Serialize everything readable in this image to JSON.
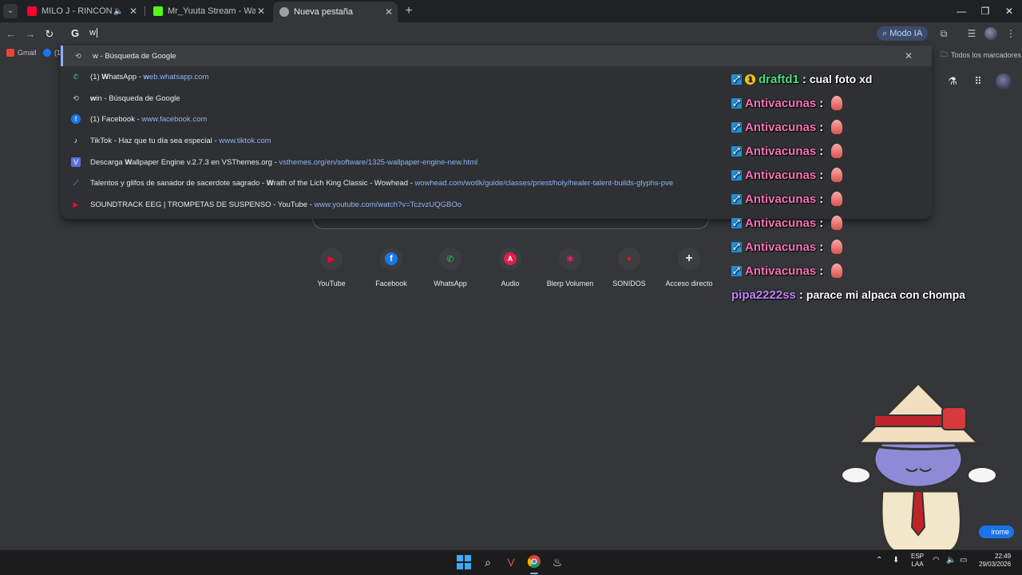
{
  "tabs": [
    {
      "title": "MILO J - RINCÓN (En Vivo | ",
      "favicon_color": "#ff0033",
      "muted_icon": "speaker-icon"
    },
    {
      "title": "Mr_Yuuta Stream - Watch Live",
      "favicon_color": "#53fc18"
    },
    {
      "title": "Nueva pestaña",
      "favicon_color": "#9aa0a6",
      "active": true
    }
  ],
  "omnibox": {
    "value": "w",
    "modo_ia": "Modo IA"
  },
  "bookmarks": {
    "gmail": "Gmail",
    "facebook_count": "(1",
    "all_bookmarks": "Todos los marcadores"
  },
  "suggestions": [
    {
      "bold": "w",
      "rest": " - Búsqueda de Google",
      "url": "",
      "icon": "history-icon",
      "selected": true
    },
    {
      "prefix": "(1) ",
      "bold": "W",
      "rest": "hatsApp - ",
      "url": "web.whatsapp.com",
      "url_bold": "w",
      "icon": "whatsapp-icon"
    },
    {
      "bold": "w",
      "rest": "in - Búsqueda de Google",
      "url": "",
      "icon": "history-icon"
    },
    {
      "prefix": "(1) Facebook - ",
      "bold": "",
      "rest": "",
      "url": "www.facebook.com",
      "url_bold": "w",
      "icon": "facebook-icon"
    },
    {
      "prefix": "TikTok - Haz que tu día sea especial - ",
      "bold": "",
      "rest": "",
      "url": "www.tiktok.com",
      "url_bold": "w",
      "icon": "tiktok-icon"
    },
    {
      "prefix": "Descarga ",
      "bold": "W",
      "rest": "allpaper Engine v.2.7.3 en VSThemes.org - ",
      "url": "vsthemes.org/en/software/1325-wallpaper-engine-new.html",
      "url_bold": "",
      "icon": "vsthemes-icon"
    },
    {
      "prefix": "Talentos y glifos de sanador de sacerdote sagrado - ",
      "bold": "W",
      "rest": "rath of the Lich King Classic - Wowhead - ",
      "url": "wowhead.com/wotlk/guide/classes/priest/holy/healer-talent-builds-glyphs-pve",
      "url_bold": "w",
      "icon": "wowhead-icon"
    },
    {
      "prefix": "SOUNDTRACK EEG | TROMPETAS DE SUSPENSO - YouTube - ",
      "bold": "",
      "rest": "",
      "url": "www.youtube.com/watch?v=TczvzUQGBOo",
      "url_bold": "w",
      "icon": "youtube-icon"
    }
  ],
  "shortcuts": [
    {
      "label": "YouTube",
      "glyph": "▶",
      "color": "#ff0033"
    },
    {
      "label": "Facebook",
      "glyph": "f",
      "color": "#1877f2"
    },
    {
      "label": "WhatsApp",
      "glyph": "✆",
      "color": "#25d366"
    },
    {
      "label": "Audio",
      "glyph": "A",
      "color": "#e11d48"
    },
    {
      "label": "Blerp Volumen",
      "glyph": "✱",
      "color": "#e0245e"
    },
    {
      "label": "SONIDOS",
      "glyph": "●",
      "color": "#c81e1e"
    },
    {
      "label": "Acceso directo",
      "glyph": "+",
      "color": "#e8eaed"
    }
  ],
  "chat": [
    {
      "user": "draftd1",
      "text": "cual foto xd",
      "color": "green",
      "badges": 2
    },
    {
      "user": "Antivacunas",
      "text": "",
      "color": "pink",
      "badges": 1,
      "emote": true
    },
    {
      "user": "Antivacunas",
      "text": "",
      "color": "pink",
      "badges": 1,
      "emote": true
    },
    {
      "user": "Antivacunas",
      "text": "",
      "color": "pink",
      "badges": 1,
      "emote": true
    },
    {
      "user": "Antivacunas",
      "text": "",
      "color": "pink",
      "badges": 1,
      "emote": true
    },
    {
      "user": "Antivacunas",
      "text": "",
      "color": "pink",
      "badges": 1,
      "emote": true
    },
    {
      "user": "Antivacunas",
      "text": "",
      "color": "pink",
      "badges": 1,
      "emote": true
    },
    {
      "user": "Antivacunas",
      "text": "",
      "color": "pink",
      "badges": 1,
      "emote": true
    },
    {
      "user": "Antivacunas",
      "text": "",
      "color": "pink",
      "badges": 1,
      "emote": true
    },
    {
      "user": "pipa2222ss",
      "text": "parace mi alpaca con chompa",
      "color": "purple",
      "badges": 0
    }
  ],
  "chrome_pill": "irome",
  "tray": {
    "lang1": "ESP",
    "lang2": "LAA",
    "time": "22:49",
    "date": "29/03/2026"
  }
}
